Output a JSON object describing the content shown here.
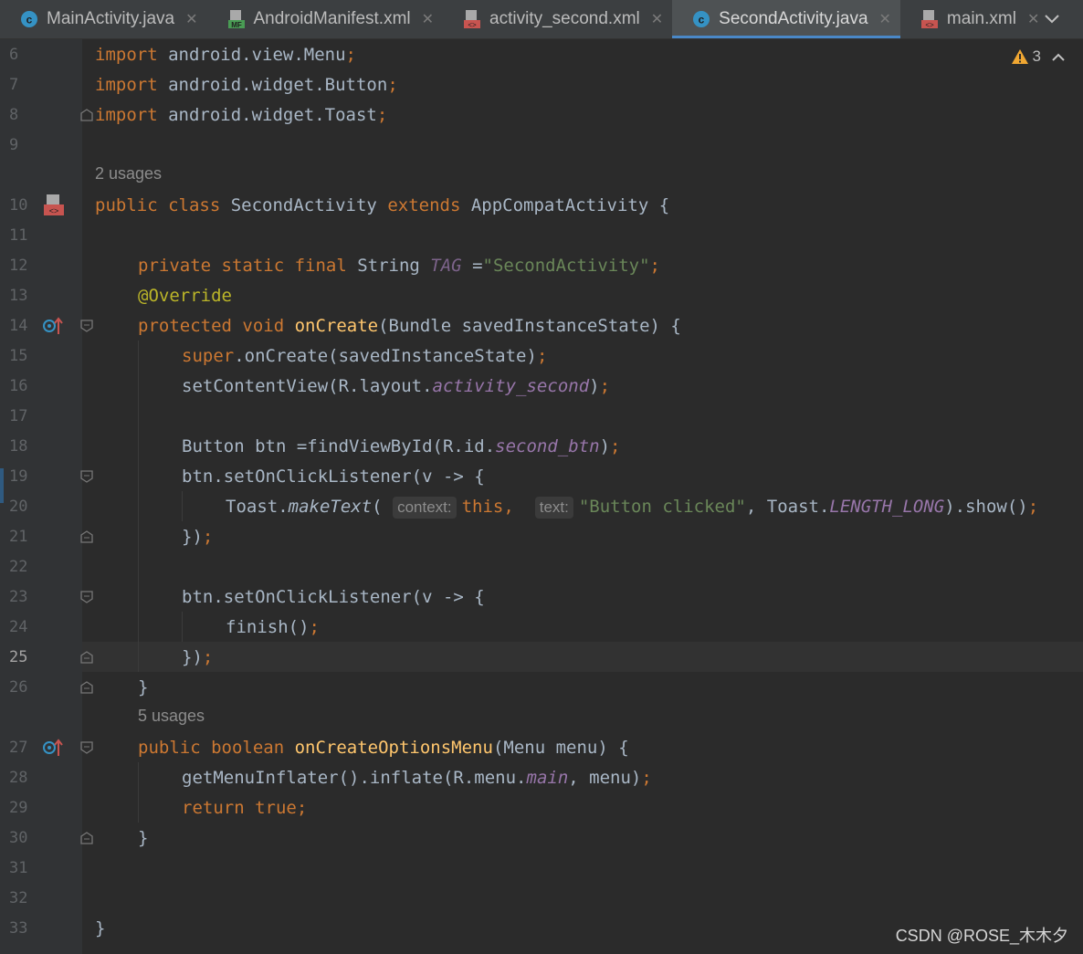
{
  "tabs": [
    {
      "label": "MainActivity.java",
      "icon": "java-class-icon"
    },
    {
      "label": "AndroidManifest.xml",
      "icon": "manifest-file-icon"
    },
    {
      "label": "activity_second.xml",
      "icon": "layout-xml-icon"
    },
    {
      "label": "SecondActivity.java",
      "icon": "java-class-icon",
      "active": true
    },
    {
      "label": "main.xml",
      "icon": "layout-xml-icon"
    }
  ],
  "inspections": {
    "warning_count": "3"
  },
  "usages": {
    "class": "2 usages",
    "method": "5 usages"
  },
  "line_numbers": [
    "6",
    "7",
    "8",
    "9",
    "10",
    "11",
    "12",
    "13",
    "14",
    "15",
    "16",
    "17",
    "18",
    "19",
    "20",
    "21",
    "22",
    "23",
    "24",
    "25",
    "26",
    "27",
    "28",
    "29",
    "30",
    "31",
    "32",
    "33"
  ],
  "current_line": "25",
  "code": {
    "l6": {
      "kw": "import",
      "rest": " android.view.Menu",
      "semi": ";"
    },
    "l7": {
      "kw": "import",
      "rest": " android.widget.Button",
      "semi": ";"
    },
    "l8": {
      "kw": "import",
      "rest": " android.widget.Toast",
      "semi": ";"
    },
    "l10": {
      "kw1": "public class",
      "name": " SecondActivity ",
      "kw2": "extends",
      "rest": " AppCompatActivity {"
    },
    "l12": {
      "kw": "private static final",
      "type": " String ",
      "tag": "TAG",
      "eq": " =",
      "str": "\"SecondActivity\"",
      "semi": ";"
    },
    "l13": {
      "ann": "@Override"
    },
    "l14": {
      "kw": "protected void",
      "fn": " onCreate",
      "rest": "(Bundle savedInstanceState) {"
    },
    "l15": {
      "kw": "super",
      "rest": ".onCreate(savedInstanceState)",
      "semi": ";"
    },
    "l16": {
      "pre": "setContentView(R.layout.",
      "fld": "activity_second",
      "post": ")",
      "semi": ";"
    },
    "l18": {
      "pre": "Button btn =findViewById(R.id.",
      "fld": "second_btn",
      "post": ")",
      "semi": ";"
    },
    "l19": {
      "text": "btn.setOnClickListener(v -> {"
    },
    "l20": {
      "pre": "Toast.",
      "m": "makeText",
      "open": "(",
      "hint1": "context:",
      "kw": "this",
      "c1": ", ",
      "hint2": "text:",
      "str": "\"Button clicked\"",
      "c2": ", Toast.",
      "fld": "LENGTH_LONG",
      "post": ").show()",
      "semi": ";"
    },
    "l21": {
      "text": "})",
      "semi": ";"
    },
    "l23": {
      "text": "btn.setOnClickListener(v -> {"
    },
    "l24": {
      "text": "finish()",
      "semi": ";"
    },
    "l25": {
      "text": "})",
      "semi": ";"
    },
    "l26": {
      "text": "}"
    },
    "l27": {
      "kw": "public boolean",
      "fn": " onCreateOptionsMenu",
      "rest": "(Menu menu) {"
    },
    "l28": {
      "pre": "getMenuInflater().inflate(R.menu.",
      "fld": "main",
      "post": ", menu)",
      "semi": ";"
    },
    "l29": {
      "kw": "return true",
      "semi": ";"
    },
    "l30": {
      "text": "}"
    },
    "l33": {
      "text": "}"
    }
  },
  "watermark": "CSDN @ROSE_木木夕"
}
